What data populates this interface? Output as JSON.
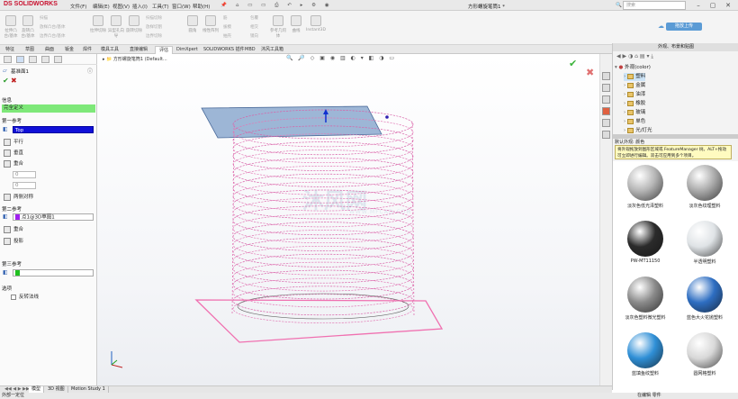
{
  "titlebar": {
    "logo": "DS SOLIDWORKS",
    "menus": [
      "文件(F)",
      "编辑(E)",
      "视图(V)",
      "插入(I)",
      "工具(T)",
      "窗口(W)",
      "帮助(H)"
    ],
    "document_title": "方形螺旋笔筒1 *",
    "search_placeholder": "搜索",
    "upload_button": "拖放上传"
  },
  "ribbon": {
    "buttons": [
      "拉伸凸台/基体",
      "旋转凸台/基体",
      "扫描",
      "放样凸台/基体",
      "边界凸台/基体",
      "拉伸切除",
      "异型孔向导",
      "旋转切除",
      "扫描切除",
      "放样切割",
      "边界切除",
      "圆角",
      "线性阵列",
      "拉伸",
      "筋",
      "包覆",
      "拔模",
      "相交",
      "抽壳",
      "镜向",
      "参考几何体",
      "曲线",
      "Instant3D"
    ]
  },
  "tabs": [
    "特征",
    "草图",
    "曲面",
    "钣金",
    "焊件",
    "模具工具",
    "直接编辑",
    "评估",
    "DimXpert",
    "SOLIDWORKS 插件",
    "MBD",
    "沐风工具箱"
  ],
  "active_tab": "评估",
  "left_panel": {
    "title": "基准面1",
    "message_label": "信息",
    "message_value": "完全定义",
    "first_ref_label": "第一参考",
    "first_ref_value": "Top",
    "first_options": [
      "平行",
      "垂直",
      "重合"
    ],
    "first_angle": "0",
    "first_offset": "0",
    "flip_label": "两侧对称",
    "second_ref_label": "第二参考",
    "second_ref_value": "点1@3D草图1",
    "second_options": [
      "重合",
      "投影"
    ],
    "third_ref_label": "第三参考",
    "third_ref_value": "",
    "options_label": "选项",
    "options_checkbox": "反转法线"
  },
  "viewport": {
    "tree_path": "方形螺旋笔筒1 (Default...",
    "watermark": "沐风网",
    "watermark_sub": "WWW.MFCAD.COM"
  },
  "right_pane": {
    "header": "外观、布景和贴图",
    "tree": [
      {
        "label": "外观(color)",
        "expanded": true
      },
      {
        "label": "塑料"
      },
      {
        "label": "金属"
      },
      {
        "label": "油漆"
      },
      {
        "label": "橡胶"
      },
      {
        "label": "玻璃"
      },
      {
        "label": "单色"
      },
      {
        "label": "光/灯光"
      }
    ],
    "desc_title": "默认外观: 颜色",
    "tooltip": "将外观拖放到图形区域或 FeatureManager 树。ALT+拖动可立即进行编辑。双击可应用到多个项目。",
    "materials": [
      {
        "name": "淡灰色低光泽塑料",
        "color": "#b5b5b5"
      },
      {
        "name": "淡灰色纹理塑料",
        "color": "#aaaaaa"
      },
      {
        "name": "PW-MT11150",
        "color": "#2b2b2b"
      },
      {
        "name": "半透明塑料",
        "color": "#dfe3e6"
      },
      {
        "name": "淡灰色塑料微光塑料",
        "color": "#8a8a8a"
      },
      {
        "name": "蓝色大火花抛塑料",
        "color": "#2e6ec2"
      },
      {
        "name": "蓝填鱼纹塑料",
        "color": "#2f8fd6"
      },
      {
        "name": "圆网格塑料",
        "color": "#d8d8d8"
      }
    ]
  },
  "bottom_tabs": [
    "模型",
    "3D 视图",
    "Motion Study 1"
  ],
  "status": {
    "left": "外部一定位",
    "right": "在编辑 零件"
  }
}
